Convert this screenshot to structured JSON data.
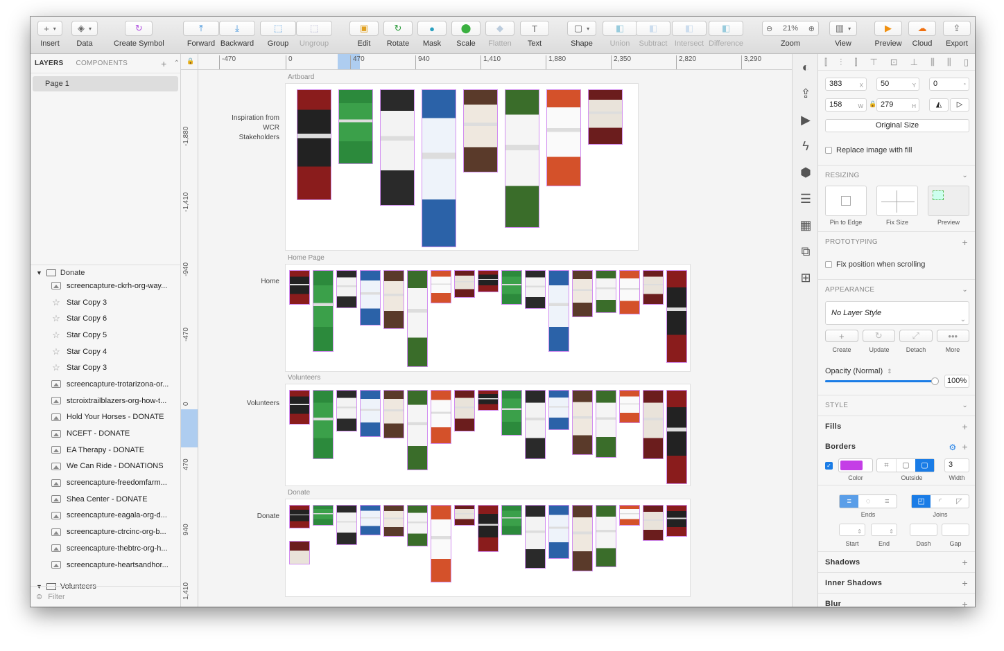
{
  "toolbar": {
    "insert": "Insert",
    "data": "Data",
    "create_symbol": "Create Symbol",
    "forward": "Forward",
    "backward": "Backward",
    "group": "Group",
    "ungroup": "Ungroup",
    "edit": "Edit",
    "rotate": "Rotate",
    "mask": "Mask",
    "scale": "Scale",
    "flatten": "Flatten",
    "text": "Text",
    "shape": "Shape",
    "union": "Union",
    "subtract": "Subtract",
    "intersect": "Intersect",
    "difference": "Difference",
    "zoom_label": "Zoom",
    "zoom_value": "21%",
    "view": "View",
    "preview": "Preview",
    "cloud": "Cloud",
    "export": "Export"
  },
  "left": {
    "tab_layers": "LAYERS",
    "tab_components": "COMPONENTS",
    "page": "Page 1",
    "group": "Donate",
    "layers": [
      {
        "icon": "image",
        "label": "screencapture-ckrh-org-way..."
      },
      {
        "icon": "star",
        "label": "Star Copy 3"
      },
      {
        "icon": "star",
        "label": "Star Copy 6"
      },
      {
        "icon": "star",
        "label": "Star Copy 5"
      },
      {
        "icon": "star",
        "label": "Star Copy 4"
      },
      {
        "icon": "star",
        "label": "Star Copy 3"
      },
      {
        "icon": "image",
        "label": "screencapture-trotarizona-or..."
      },
      {
        "icon": "image",
        "label": "stcroixtrailblazers-org-how-t..."
      },
      {
        "icon": "image",
        "label": "Hold Your Horses - DONATE"
      },
      {
        "icon": "image",
        "label": "NCEFT - DONATE"
      },
      {
        "icon": "image",
        "label": "EA Therapy - DONATE"
      },
      {
        "icon": "image",
        "label": "We Can Ride - DONATIONS"
      },
      {
        "icon": "image",
        "label": "screencapture-freedomfarm..."
      },
      {
        "icon": "image",
        "label": "Shea Center - DONATE"
      },
      {
        "icon": "image",
        "label": "screencapture-eagala-org-d..."
      },
      {
        "icon": "image",
        "label": "screencapture-ctrcinc-org-b..."
      },
      {
        "icon": "image",
        "label": "screencapture-thebtrc-org-h..."
      },
      {
        "icon": "image",
        "label": "screencapture-heartsandhor..."
      }
    ],
    "next_group": "Volunteers",
    "filter": "Filter"
  },
  "rulers": {
    "h": [
      "-470",
      "0",
      "470",
      "940",
      "1,410",
      "1,880",
      "2,350",
      "2,820",
      "3,290"
    ],
    "v": [
      "-1,880",
      "-1,410",
      "-940",
      "-470",
      "0",
      "470",
      "940",
      "1,410"
    ]
  },
  "canvas": {
    "artboards": [
      {
        "name": "Artboard",
        "side": "Inspiration from WCR Stakeholders"
      },
      {
        "name": "Home Page",
        "side": "Home"
      },
      {
        "name": "Volunteers",
        "side": "Volunteers"
      },
      {
        "name": "Donate",
        "side": "Donate"
      }
    ]
  },
  "inspector": {
    "x": "383",
    "x_unit": "X",
    "y": "50",
    "y_unit": "Y",
    "rot": "0",
    "rot_unit": "°",
    "w": "158",
    "w_unit": "W",
    "h": "279",
    "h_unit": "H",
    "original_size": "Original Size",
    "replace_fill": "Replace image with fill",
    "resizing": "RESIZING",
    "pin_to_edge": "Pin to Edge",
    "fix_size": "Fix Size",
    "preview": "Preview",
    "prototyping": "PROTOTYPING",
    "fix_position": "Fix position when scrolling",
    "appearance": "APPEARANCE",
    "layer_style": "No Layer Style",
    "create": "Create",
    "update": "Update",
    "detach": "Detach",
    "more": "More",
    "opacity_label": "Opacity (Normal)",
    "opacity": "100%",
    "opacity_fraction": 1.0,
    "style": "STYLE",
    "fills": "Fills",
    "borders": "Borders",
    "border_color": "#c43ee6",
    "border_color_label": "Color",
    "border_position": "Outside",
    "border_width": "3",
    "width_label": "Width",
    "ends": "Ends",
    "joins": "Joins",
    "start": "Start",
    "end": "End",
    "dash": "Dash",
    "gap": "Gap",
    "shadows": "Shadows",
    "inner_shadows": "Inner Shadows",
    "blur": "Blur"
  },
  "colors": {
    "accent": "#1a7ce6",
    "border_pink": "#d28ef0"
  }
}
